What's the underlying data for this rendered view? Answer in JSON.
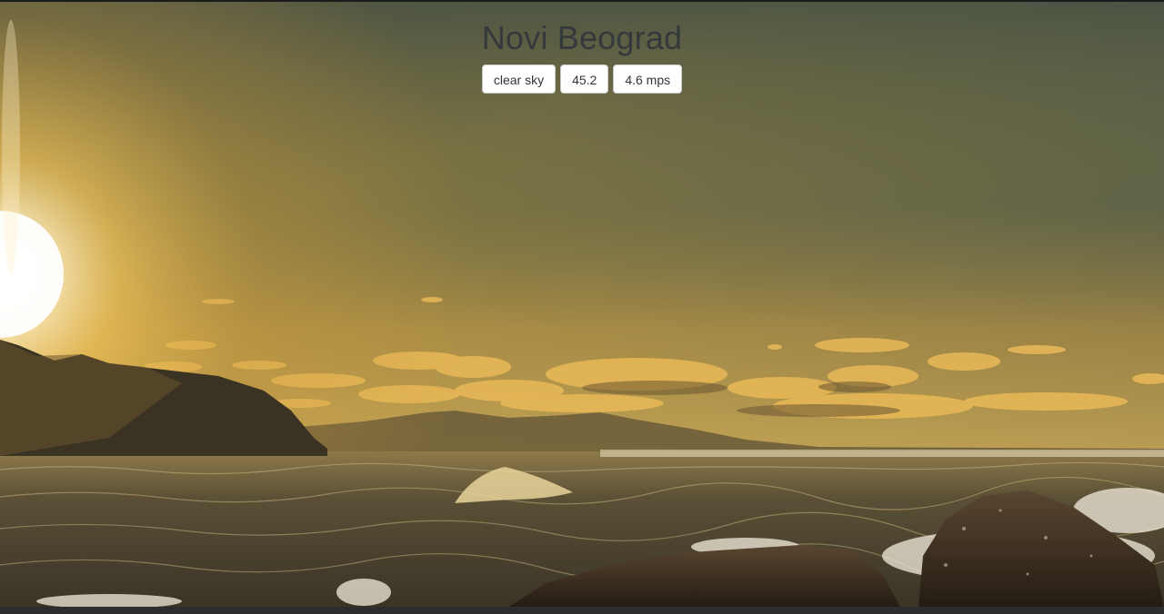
{
  "weather": {
    "city": "Novi Beograd",
    "condition": "clear sky",
    "temperature": "45.2",
    "wind": "4.6 mps"
  },
  "background": {
    "icon": "sunset-seascape-photo",
    "sky_top": "#3b4a45",
    "sky_horizon": "#e7b54a",
    "sun": "#fff8e6",
    "sea": "#3c3a2c"
  }
}
